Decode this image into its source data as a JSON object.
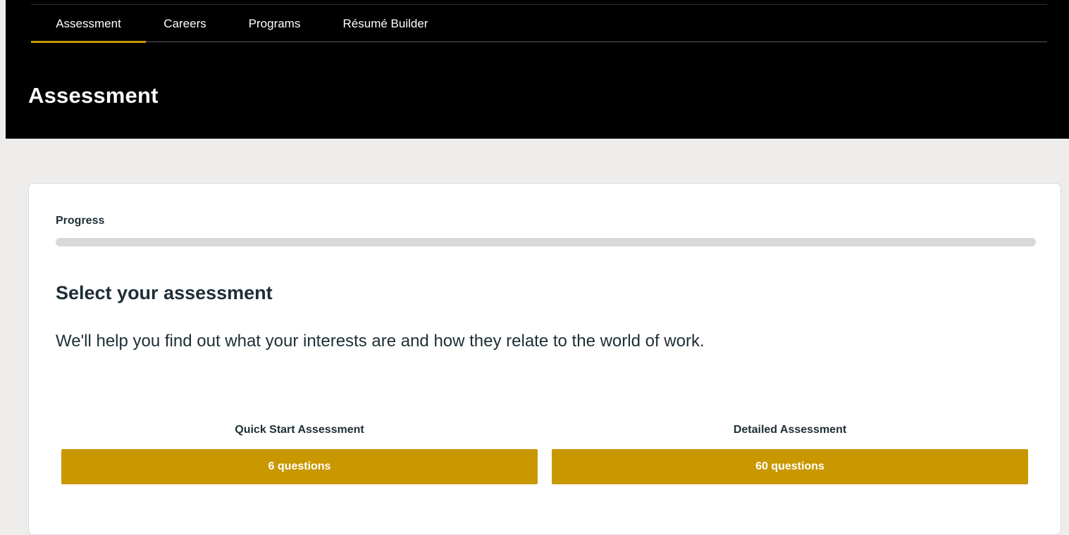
{
  "nav": {
    "tabs": [
      {
        "label": "Assessment",
        "active": true
      },
      {
        "label": "Careers",
        "active": false
      },
      {
        "label": "Programs",
        "active": false
      },
      {
        "label": "Résumé Builder",
        "active": false
      }
    ]
  },
  "header": {
    "title": "Assessment"
  },
  "card": {
    "progress": {
      "label": "Progress",
      "value_percent": 0
    },
    "title": "Select your assessment",
    "description": "We'll help you find out what your interests are and how they relate to the world of work.",
    "options": [
      {
        "label": "Quick Start Assessment",
        "button": "6 questions"
      },
      {
        "label": "Detailed Assessment",
        "button": "60 questions"
      }
    ]
  },
  "colors": {
    "accent": "#c99700",
    "header_bg": "#000000",
    "page_bg": "#eeedeb",
    "text_dark": "#1e2e36",
    "progress_track": "#d8d8d8"
  }
}
